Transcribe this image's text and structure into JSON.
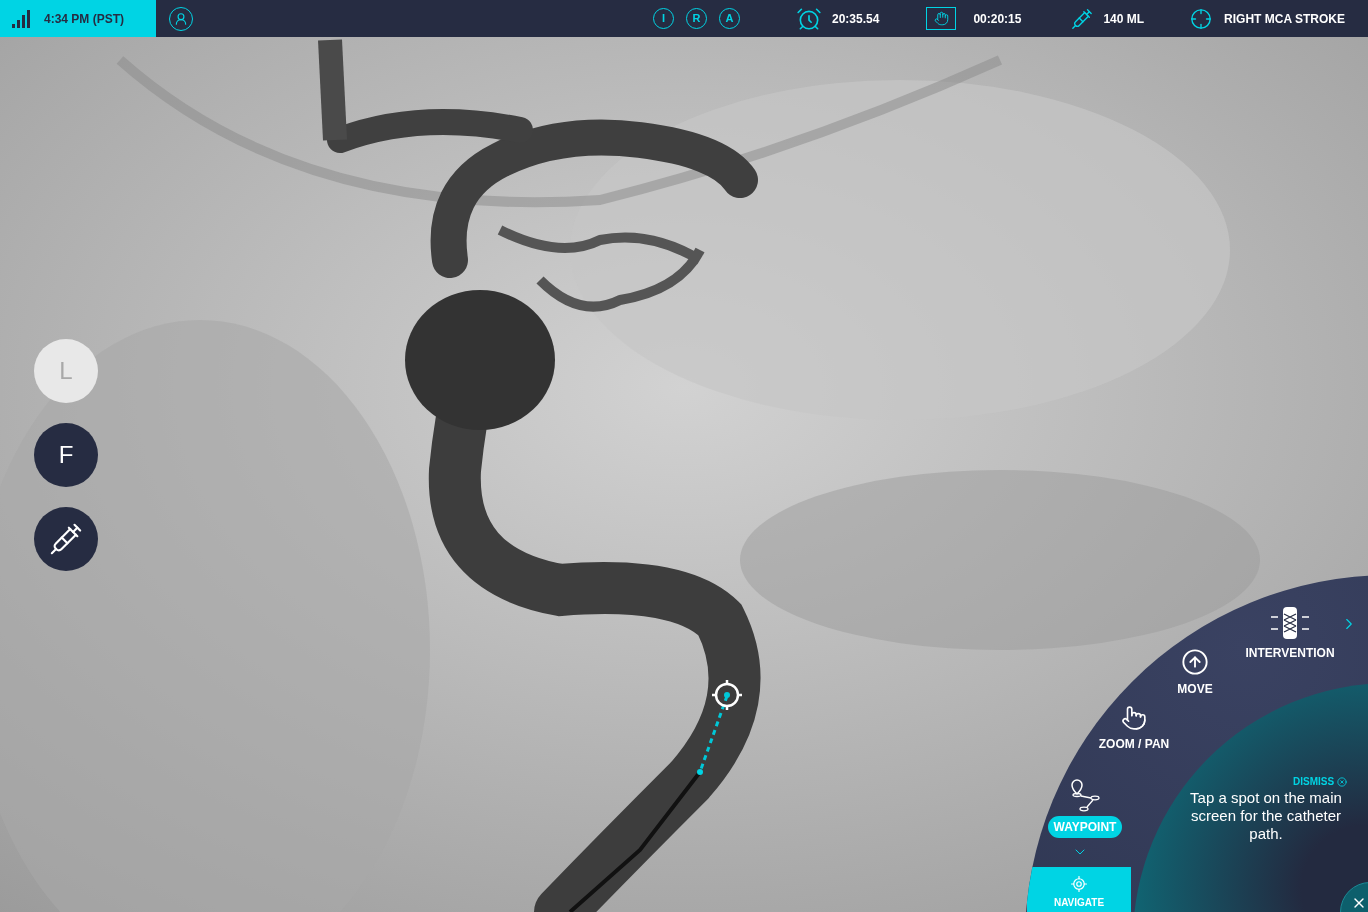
{
  "status_bar": {
    "time": "4:34 PM (PST)",
    "views": [
      {
        "label": "I"
      },
      {
        "label": "R"
      },
      {
        "label": "A"
      }
    ],
    "timer": "20:35.54",
    "fluoro_time": "00:20:15",
    "contrast": "140 ML",
    "case": "RIGHT MCA STROKE"
  },
  "side_buttons": [
    {
      "kind": "letter",
      "label": "L",
      "disabled": true
    },
    {
      "kind": "letter",
      "label": "F",
      "disabled": false
    },
    {
      "kind": "syringe",
      "disabled": false
    }
  ],
  "radial_menu": {
    "items": [
      {
        "kind": "intervention",
        "label": "INTERVENTION",
        "selected": false
      },
      {
        "kind": "move",
        "label": "MOVE",
        "selected": false
      },
      {
        "kind": "zoom",
        "label": "ZOOM / PAN",
        "selected": false
      },
      {
        "kind": "waypoint",
        "label": "WAYPOINT",
        "selected": true
      }
    ],
    "mode": {
      "label": "NAVIGATE",
      "selected": true
    },
    "hint": {
      "dismiss": "DISMISS",
      "text": "Tap a spot on the main screen for the catheter path."
    }
  }
}
